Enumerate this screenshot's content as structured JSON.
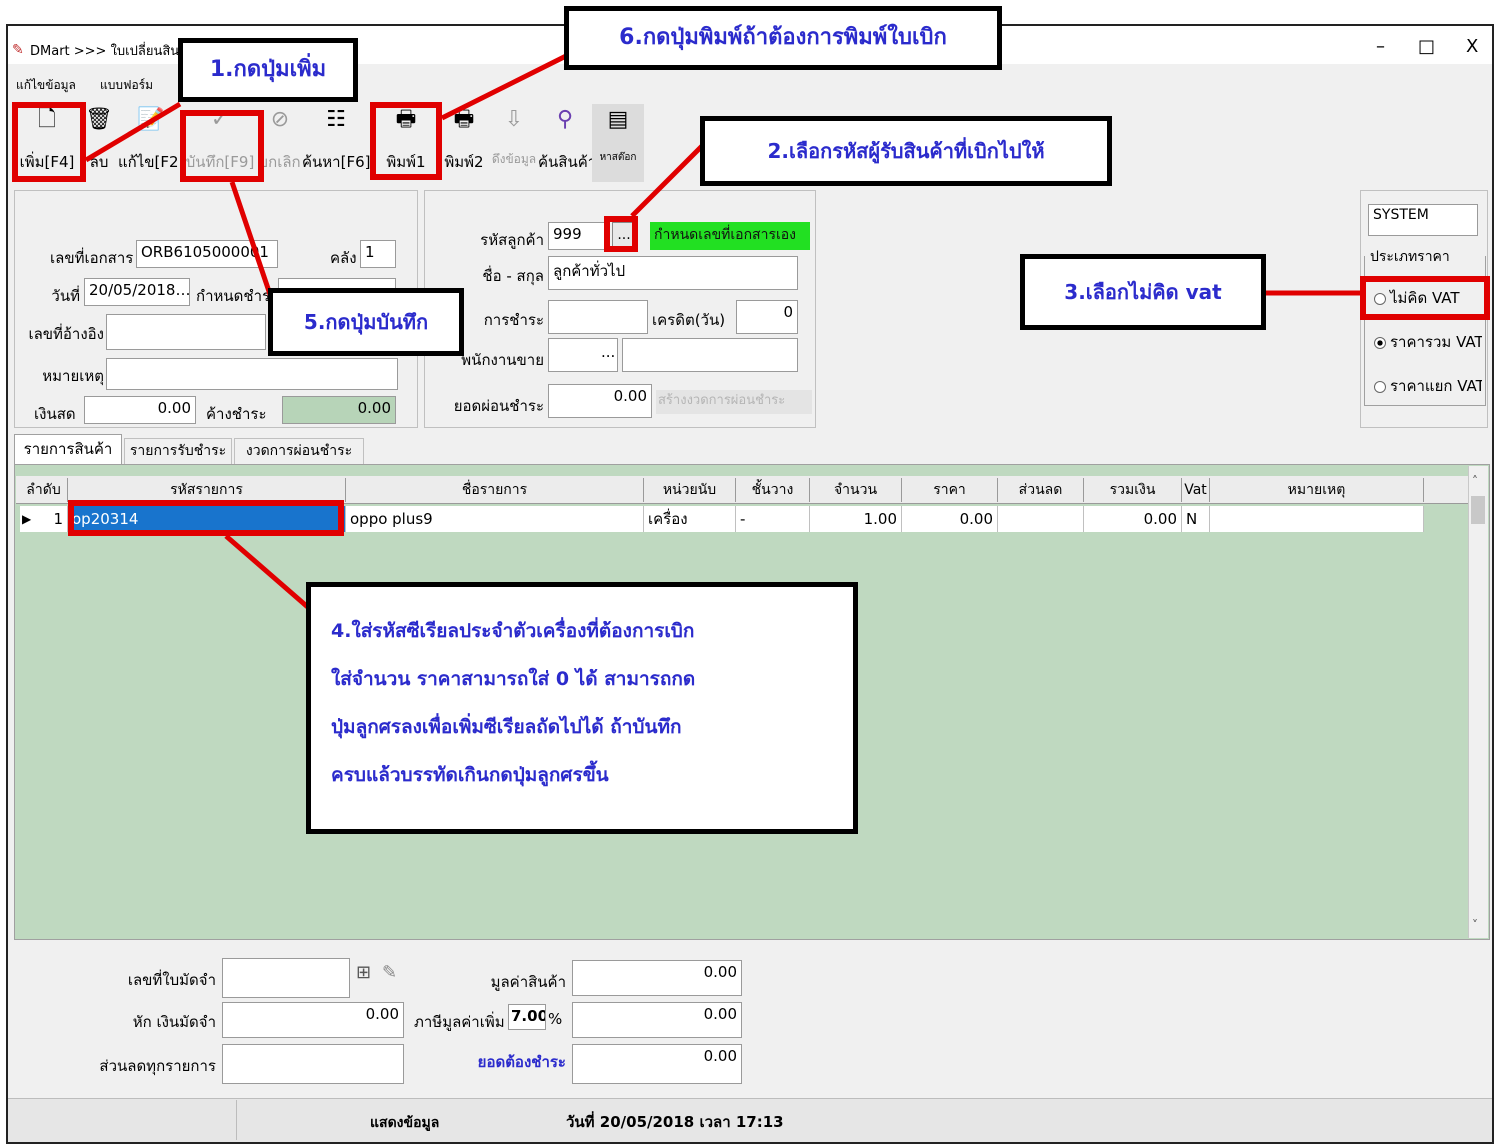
{
  "window": {
    "title": "DMart >>> ใบเปลี่ยนสินค้า",
    "controls": {
      "minimize": "–",
      "restore": "□",
      "close": "X"
    }
  },
  "menu": [
    "แก้ไขข้อมูล",
    "แบบฟอร์ม"
  ],
  "toolbar": {
    "add": "เพิ่ม[F4]",
    "delete": "ลบ",
    "edit": "แก้ไข[F2]",
    "save": "บันทึก[F9]",
    "cancel": "ยกเลิก",
    "search": "ค้นหา[F6]",
    "print1": "พิมพ์1",
    "print2": "พิมพ์2",
    "fetch": "ดึงข้อมูล",
    "find_product": "ค้นสินค้า",
    "stock": "หาสต๊อก"
  },
  "header_form": {
    "doc_no_label": "เลขที่เอกสาร",
    "doc_no": "ORB6105000001",
    "warehouse_label": "คลัง",
    "warehouse": "1",
    "date_label": "วันที่",
    "date": "20/05/2018",
    "due_label": "กำหนดชำระ",
    "ref_label": "เลขที่อ้างอิง",
    "ref": "",
    "note_label": "หมายเหตุ",
    "note": "",
    "cash_label": "เงินสด",
    "cash": "0.00",
    "outstanding_label": "ค้างชำระ",
    "outstanding": "0.00"
  },
  "customer_form": {
    "code_label": "รหัสลูกค้า",
    "code": "999",
    "lookup_button": "...",
    "doc_no_hint": "กำหนดเลขที่เอกสารเอง",
    "name_label": "ชื่อ - สกุล",
    "name": "ลูกค้าทั่วไป",
    "payment_label": "การชำระ",
    "payment": "",
    "credit_label": "เครดิต(วัน)",
    "credit": "0",
    "salesperson_label": "พนักงานขาย",
    "salesperson_lookup": "...",
    "installment_label": "ยอดผ่อนชำระ",
    "installment": "0.00",
    "create_installment": "สร้างงวดการผ่อนชำระ"
  },
  "system_box": {
    "system_label": "SYSTEM",
    "price_type_label": "ประเภทราคา",
    "options": [
      "ไม่คิด VAT",
      "ราคารวม VAT",
      "ราคาแยก VAT"
    ],
    "selected": "ราคารวม VAT"
  },
  "tabs": [
    "รายการสินค้า",
    "รายการรับชำระ",
    "งวดการผ่อนชำระ"
  ],
  "grid": {
    "columns": [
      "ลำดับ",
      "รหัสรายการ",
      "ชื่อรายการ",
      "หน่วยนับ",
      "ชั้นวาง",
      "จำนวน",
      "ราคา",
      "ส่วนลด",
      "รวมเงิน",
      "Vat",
      "หมายเหตุ"
    ],
    "rows": [
      {
        "seq": "1",
        "code": "op20314",
        "name": "oppo plus9",
        "unit": "เครื่อง",
        "shelf": "-",
        "qty": "1.00",
        "price": "0.00",
        "discount": "",
        "total": "0.00",
        "vat": "N",
        "remark": ""
      }
    ]
  },
  "footer_form": {
    "deposit_no_label": "เลขที่ใบมัดจำ",
    "deposit_no": "",
    "deduct_deposit_label": "หัก เงินมัดจำ",
    "deduct_deposit": "0.00",
    "discount_all_label": "ส่วนลดทุกรายการ",
    "discount_all": "",
    "goods_value_label": "มูลค่าสินค้า",
    "goods_value": "0.00",
    "vat_label": "ภาษีมูลค่าเพิ่ม",
    "vat_rate": "7.00",
    "vat_pct": "%",
    "vat_amount": "0.00",
    "total_due_label": "ยอดต้องชำระ",
    "total_due": "0.00"
  },
  "status_bar": {
    "mode": "แสดงข้อมูล",
    "datetime": "วันที่ 20/05/2018  เวลา 17:13"
  },
  "annotations": {
    "step1": "1.กดปุ่มเพิ่ม",
    "step2": "2.เลือกรหัสผู้รับสินค้าที่เบิกไปให้",
    "step3_prefix": "3.เลือกไม่คิด ",
    "step3_vat": "vat",
    "step4_lines": [
      "4.ใส่รหัสซีเรียลประจำตัวเครื่องที่ต้องการเบิก",
      "ใส่จำนวน ราคาสามารถใส่ 0 ได้ สามารถกด",
      "ปุ่มลูกศรลงเพื่อเพิ่มซีเรียลถัดไปได้ ถ้าบันทึก",
      "ครบแล้วบรรทัดเกินกดปุ่มลูกศรขึ้น"
    ],
    "step5": "5.กดปุ่มบันทึก",
    "step6": "6.กดปุ่มพิมพ์ถ้าต้องการพิมพ์ใบเบิก",
    "highlight_color": "#e00000",
    "text_color": "#2b2bcc"
  }
}
